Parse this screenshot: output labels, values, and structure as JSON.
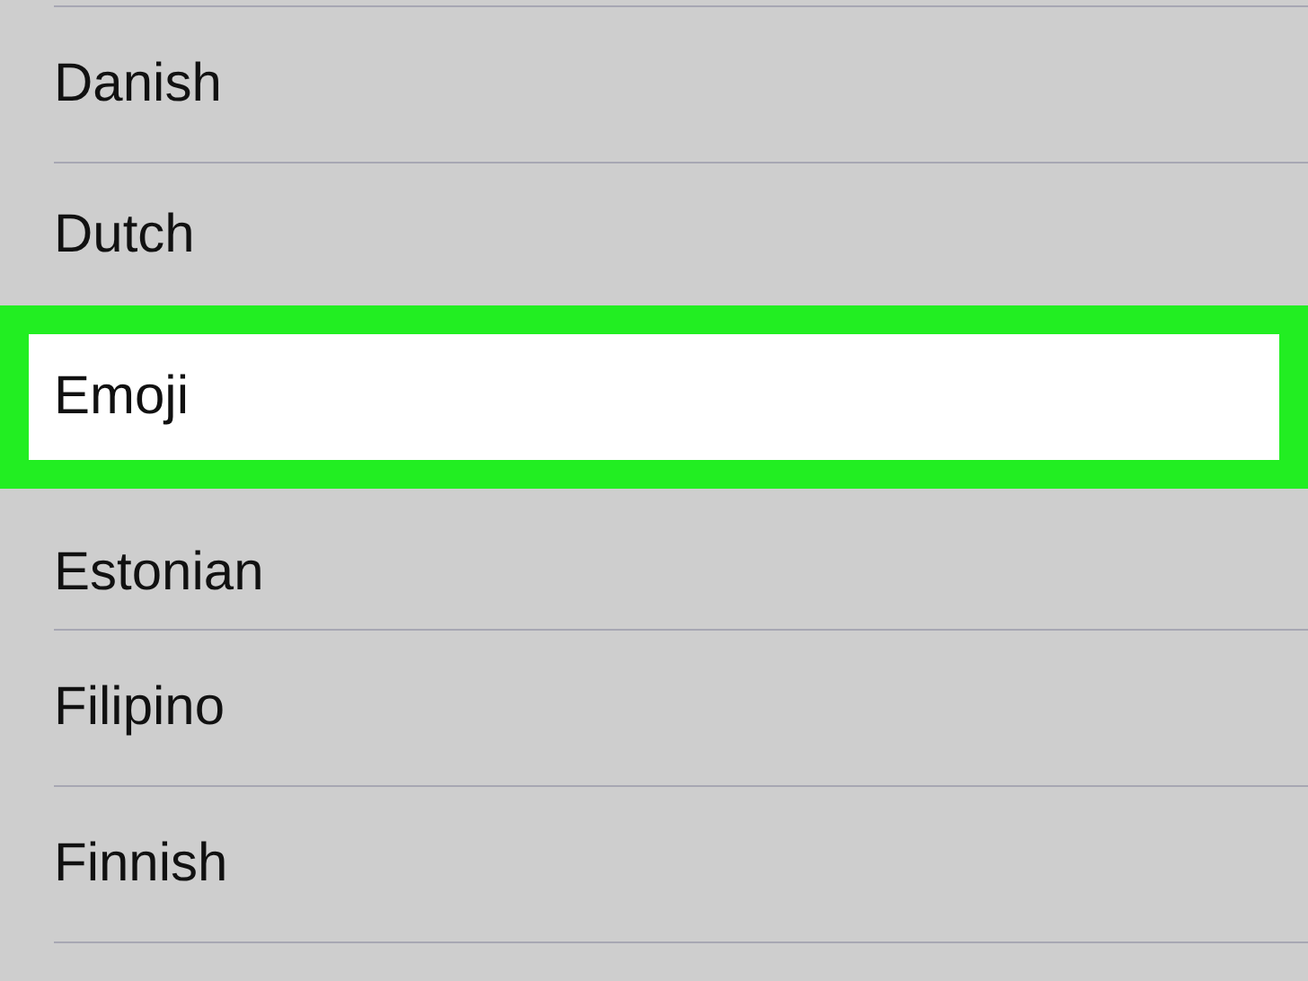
{
  "languages": [
    {
      "label": "Danish",
      "selected": false
    },
    {
      "label": "Dutch",
      "selected": false
    },
    {
      "label": "Emoji",
      "selected": true
    },
    {
      "label": "Estonian",
      "selected": false
    },
    {
      "label": "Filipino",
      "selected": false
    },
    {
      "label": "Finnish",
      "selected": false
    }
  ]
}
